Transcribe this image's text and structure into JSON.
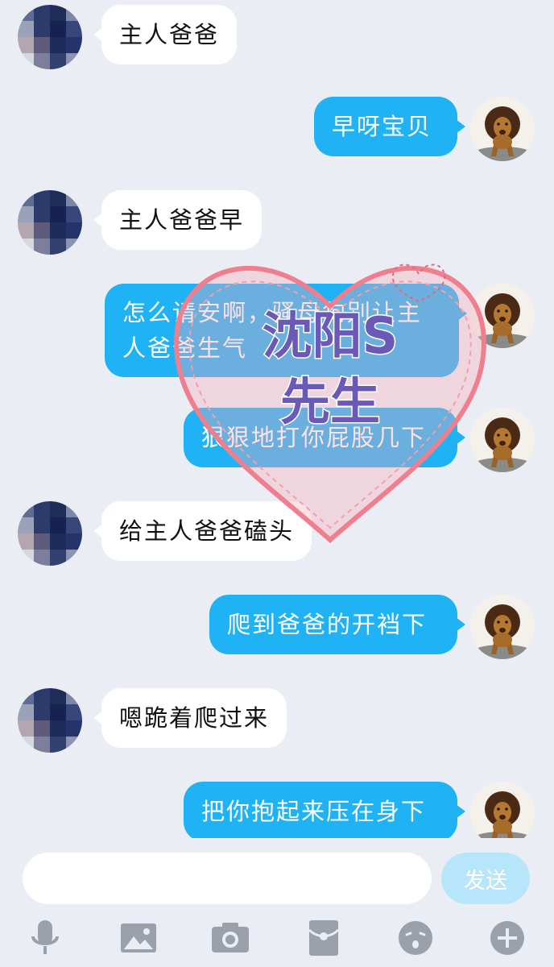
{
  "messages": [
    {
      "side": "in",
      "text": "主人爸爸"
    },
    {
      "side": "out",
      "text": "早呀宝贝"
    },
    {
      "side": "in",
      "text": "主人爸爸早"
    },
    {
      "side": "out",
      "line1": "怎么请安啊，骚母狗别让主",
      "line2": "人爸爸生气"
    },
    {
      "side": "out",
      "text": "狠狠地打你屁股几下"
    },
    {
      "side": "in",
      "text": "给主人爸爸磕头"
    },
    {
      "side": "out",
      "text": "爬到爸爸的开裆下"
    },
    {
      "side": "in",
      "text": "嗯跪着爬过来"
    },
    {
      "side": "out",
      "text": "把你抱起来压在身下"
    }
  ],
  "watermark": {
    "line1": "沈阳S",
    "line2": "先生"
  },
  "input": {
    "placeholder": "",
    "send_label": "发送"
  },
  "toolbar": {
    "icons": [
      "microphone-icon",
      "image-icon",
      "camera-icon",
      "red-envelope-icon",
      "emoji-icon",
      "plus-icon"
    ]
  },
  "colors": {
    "background": "#eaedf4",
    "outgoing_bubble": "#1fb2f5",
    "incoming_bubble": "#ffffff",
    "send_button": "#b7e6fb",
    "watermark_text": "#6b59b8"
  }
}
